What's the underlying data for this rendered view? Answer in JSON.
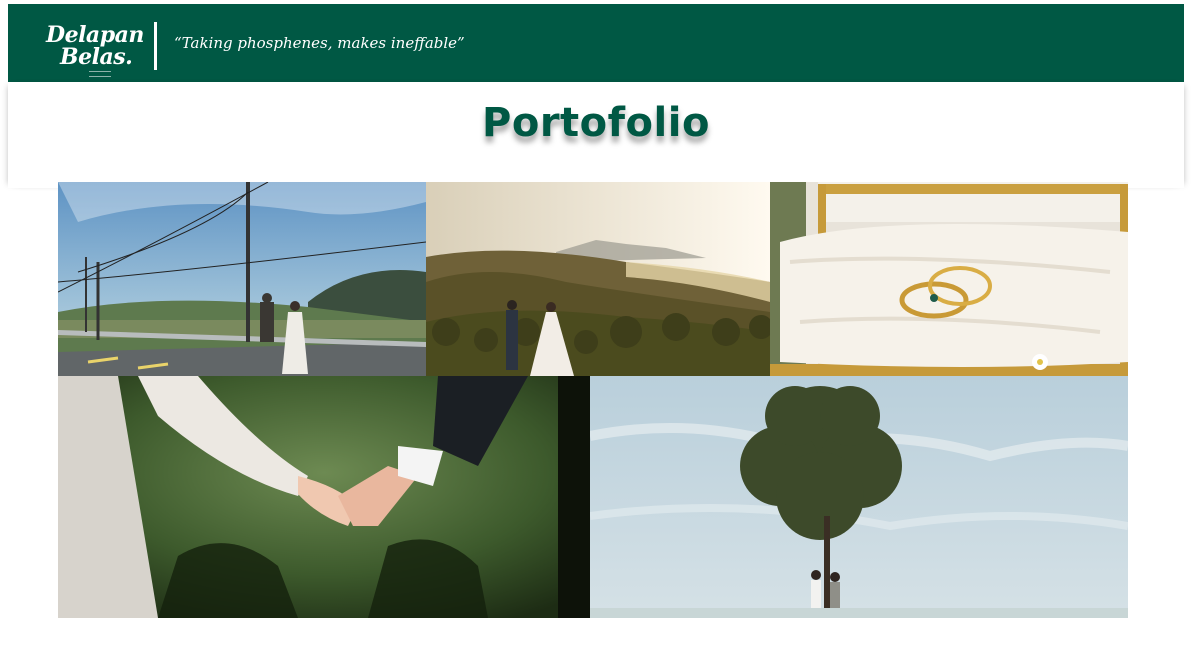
{
  "header": {
    "brand_line1": "Delapan",
    "brand_line2": "Belas.",
    "tagline": "“Taking phosphenes, makes ineffable”"
  },
  "main": {
    "title": "Portofolio"
  },
  "gallery": [
    {
      "subject": "couple walking along roadside with power lines"
    },
    {
      "subject": "couple holding hands overlooking misty hills at sunset"
    },
    {
      "subject": "two gold rings on white fabric in gold box"
    },
    {
      "subject": "close-up of bride and groom holding hands"
    },
    {
      "subject": "couple standing under a lone round tree against sky"
    }
  ],
  "colors": {
    "brand_green": "#005844",
    "title_green": "#005844",
    "background": "#ffffff"
  }
}
